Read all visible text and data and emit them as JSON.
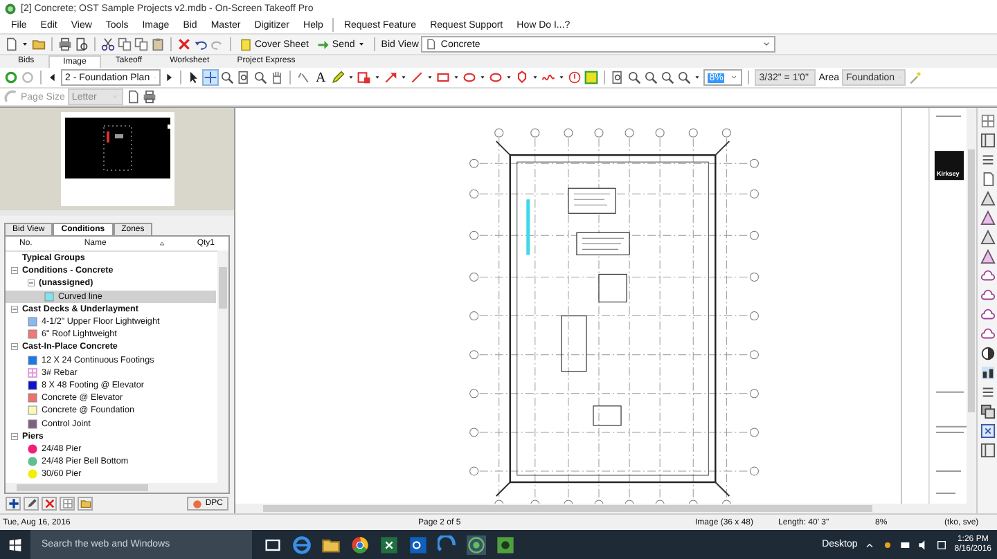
{
  "window": {
    "title": "[2] Concrete; OST Sample Projects v2.mdb - On-Screen Takeoff Pro"
  },
  "menu": [
    "File",
    "Edit",
    "View",
    "Tools",
    "Image",
    "Bid",
    "Master",
    "Digitizer",
    "Help"
  ],
  "menu_links": [
    "Request Feature",
    "Request Support",
    "How Do I...?"
  ],
  "toolbar": {
    "cover_sheet": "Cover Sheet",
    "send": "Send",
    "bid_view_label": "Bid View",
    "bid_view": "Concrete"
  },
  "ribbon_tabs": [
    {
      "label": "Bids",
      "selected": false
    },
    {
      "label": "Image",
      "selected": true
    },
    {
      "label": "Takeoff",
      "selected": false
    },
    {
      "label": "Worksheet",
      "selected": false
    },
    {
      "label": "Project Express",
      "selected": false
    }
  ],
  "page_toolbar": {
    "page": "2 - Foundation Plan",
    "text_tool": "A",
    "zoom": "8%",
    "scale": "3/32\" = 1'0\"",
    "area_label": "Area",
    "area": "Foundation"
  },
  "print_bar": {
    "page_size_label": "Page Size",
    "page_size": "Letter"
  },
  "panel": {
    "tabs": [
      {
        "label": "Bid View",
        "selected": false
      },
      {
        "label": "Conditions",
        "selected": true
      },
      {
        "label": "Zones",
        "selected": false
      }
    ],
    "columns": [
      "No.",
      "Name",
      "Qty1"
    ],
    "tree": [
      {
        "label": "Typical Groups",
        "kind": "group"
      },
      {
        "label": "Conditions - Concrete",
        "kind": "group",
        "expanded": true,
        "children": [
          {
            "label": "(unassigned)",
            "kind": "subgroup",
            "expanded": true,
            "children": [
              {
                "label": "Curved line",
                "kind": "area",
                "color": "#80e4ee",
                "selected": true
              }
            ]
          }
        ]
      },
      {
        "label": "Cast Decks & Underlayment",
        "kind": "group",
        "expanded": true,
        "children": [
          {
            "label": "4-1/2\" Upper Floor Lightweight",
            "kind": "area",
            "color": "#8ab8f0",
            "selected": false
          },
          {
            "label": "6\" Roof Lightweight",
            "kind": "area",
            "color": "#f07878",
            "selected": false
          }
        ]
      },
      {
        "label": "Cast-In-Place Concrete",
        "kind": "group",
        "expanded": true,
        "children": [
          {
            "label": "12 X 24 Continuous Footings",
            "kind": "area",
            "color": "#1e78e8",
            "selected": false
          },
          {
            "label": "3# Rebar",
            "kind": "grid",
            "color": "#e0a0e0",
            "selected": false
          },
          {
            "label": "8 X 48 Footing @ Elevator",
            "kind": "area",
            "color": "#1010d0",
            "selected": false
          },
          {
            "label": "Concrete @ Elevator",
            "kind": "area",
            "color": "#f07070",
            "selected": false
          },
          {
            "label": "Concrete @ Foundation",
            "kind": "area",
            "color": "#f8f8b8",
            "selected": false
          },
          {
            "label": "Control Joint",
            "kind": "area",
            "color": "#806080",
            "selected": false
          }
        ]
      },
      {
        "label": "Piers",
        "kind": "group",
        "expanded": true,
        "children": [
          {
            "label": "24/48 Pier",
            "kind": "count",
            "color": "#f0207a",
            "selected": false
          },
          {
            "label": "24/48 Pier Bell Bottom",
            "kind": "count",
            "color": "#60c090",
            "selected": false
          },
          {
            "label": "30/60 Pier",
            "kind": "count",
            "color": "#f0f000",
            "selected": false
          }
        ]
      }
    ],
    "dpc_button": "DPC"
  },
  "drawing": {
    "logo_text": "Kirksey"
  },
  "status_bar": {
    "date": "Tue, Aug 16, 2016",
    "page": "Page 2 of 5",
    "image": "Image (36 x 48)",
    "length": "Length: 40' 3\"",
    "zoom": "8%",
    "user": "(tko, sve)"
  },
  "taskbar": {
    "search": {
      "placeholder": "Search the web and Windows"
    },
    "desktop": "Desktop",
    "time": "1:26 PM",
    "date": "8/16/2016"
  }
}
